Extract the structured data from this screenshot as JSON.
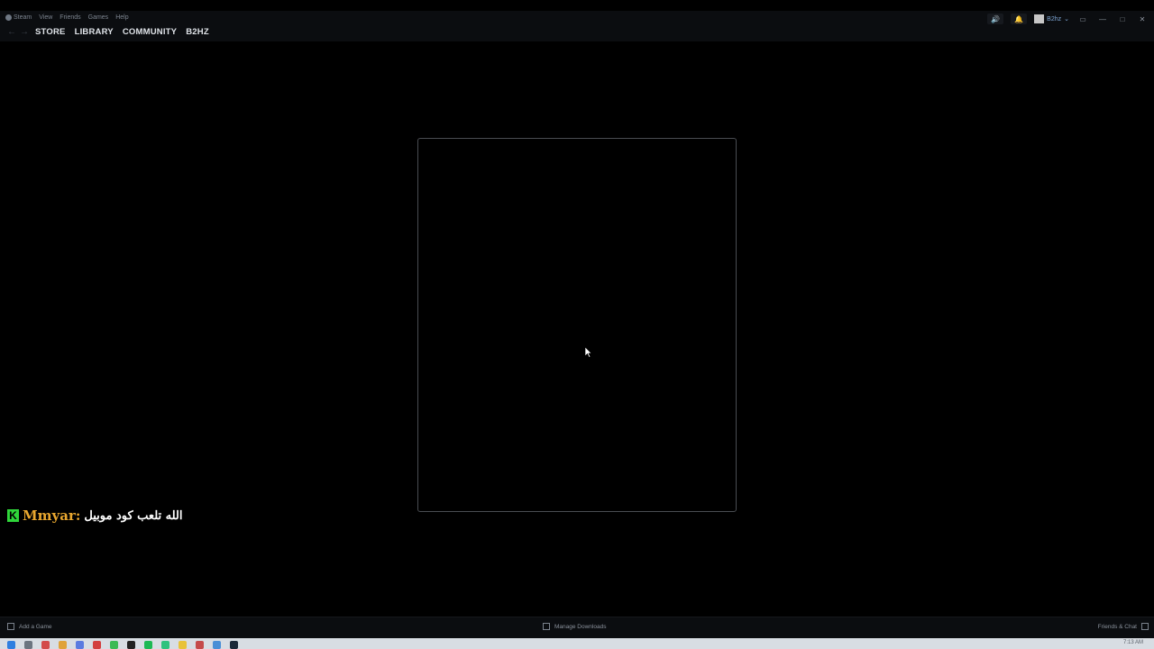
{
  "menubar": {
    "items": [
      "Steam",
      "View",
      "Friends",
      "Games",
      "Help"
    ]
  },
  "nav": {
    "back_icon": "arrow-left-icon",
    "forward_icon": "arrow-right-icon",
    "links": [
      "STORE",
      "LIBRARY",
      "COMMUNITY",
      "B2HZ"
    ]
  },
  "titlebar_right": {
    "username": "B2hz",
    "icons": [
      "broadcast-icon",
      "bell-icon",
      "avatar",
      "monitor-icon",
      "minimize-icon",
      "maximize-icon",
      "close-icon"
    ]
  },
  "overlay": {
    "badge": "K",
    "name": "Mmyar:",
    "message": "الله تلعب كود موبيل"
  },
  "bottombar": {
    "add_game": "Add a Game",
    "manage_downloads": "Manage Downloads",
    "friends_chat": "Friends & Chat"
  },
  "taskbar": {
    "clock": "7:13 AM"
  },
  "colors": {
    "background": "#000000",
    "overlay_name": "#e9a72f",
    "overlay_badge": "#2fd63a",
    "username": "#7fa7d6"
  }
}
